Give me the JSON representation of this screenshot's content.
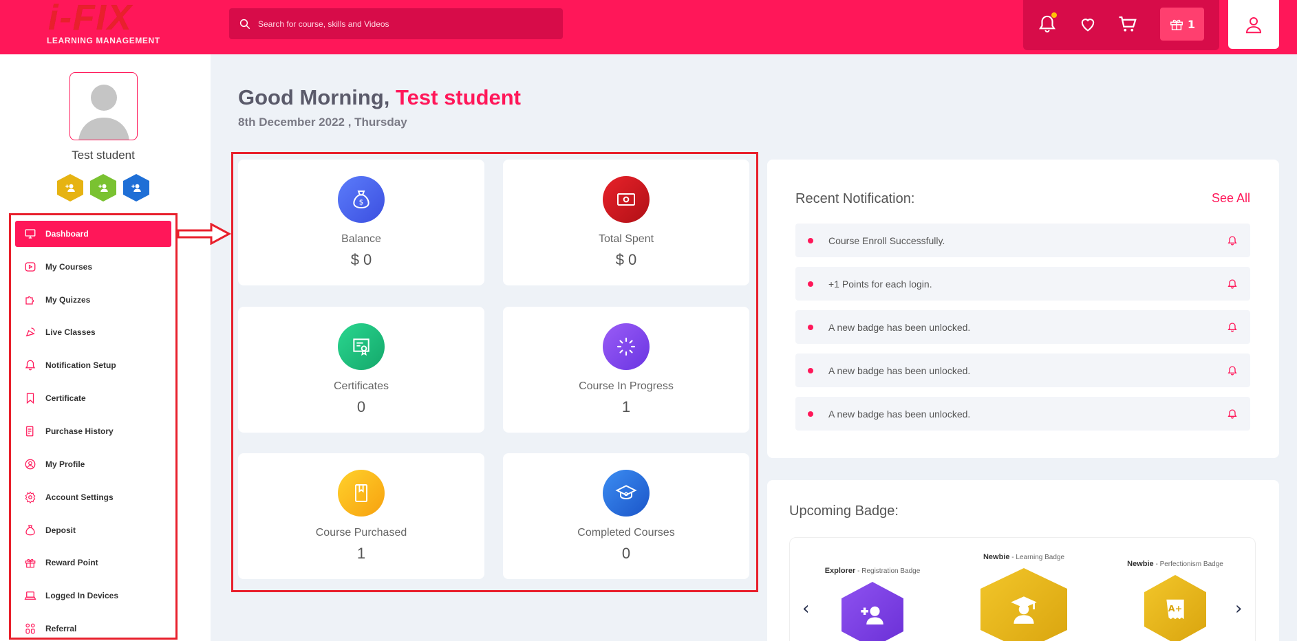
{
  "header": {
    "logo_mark": "i-FIX",
    "logo_subtitle": "LEARNING MANAGEMENT",
    "search_placeholder": "Search for course, skills and Videos",
    "gift_count": "1"
  },
  "sidebar": {
    "student_name": "Test student",
    "menu": [
      {
        "label": "Dashboard",
        "icon": "monitor-icon"
      },
      {
        "label": "My Courses",
        "icon": "play-icon"
      },
      {
        "label": "My Quizzes",
        "icon": "puzzle-icon"
      },
      {
        "label": "Live Classes",
        "icon": "broadcast-icon"
      },
      {
        "label": "Notification Setup",
        "icon": "bell-icon"
      },
      {
        "label": "Certificate",
        "icon": "bookmark-icon"
      },
      {
        "label": "Purchase History",
        "icon": "receipt-icon"
      },
      {
        "label": "My Profile",
        "icon": "user-circle-icon"
      },
      {
        "label": "Account Settings",
        "icon": "gear-icon"
      },
      {
        "label": "Deposit",
        "icon": "moneybag-icon"
      },
      {
        "label": "Reward Point",
        "icon": "gift-icon"
      },
      {
        "label": "Logged In Devices",
        "icon": "laptop-icon"
      },
      {
        "label": "Referral",
        "icon": "referral-icon"
      }
    ]
  },
  "greeting": {
    "prefix": "Good Morning,",
    "name": "Test student",
    "date": "8th December 2022 , Thursday"
  },
  "stats": [
    {
      "label": "Balance",
      "value": "$ 0",
      "icon": "money-bag-icon",
      "color": "#4a6cf7"
    },
    {
      "label": "Total Spent",
      "value": "$ 0",
      "icon": "cash-icon",
      "color": "#d4161d"
    },
    {
      "label": "Certificates",
      "value": "0",
      "icon": "certificate-icon",
      "color": "#22c583"
    },
    {
      "label": "Course In Progress",
      "value": "1",
      "icon": "spinner-icon",
      "color": "#7b4cf0"
    },
    {
      "label": "Course Purchased",
      "value": "1",
      "icon": "book-icon",
      "color": "#fbb01a"
    },
    {
      "label": "Completed Courses",
      "value": "0",
      "icon": "graduation-icon",
      "color": "#2b73e8"
    }
  ],
  "notifications": {
    "title": "Recent Notification:",
    "see_all": "See All",
    "items": [
      "Course Enroll Successfully.",
      "+1 Points for each login.",
      "A new badge has been unlocked.",
      "A new badge has been unlocked.",
      "A new badge has been unlocked."
    ]
  },
  "upcoming": {
    "title": "Upcoming Badge:",
    "badges": [
      {
        "name": "Explorer",
        "type": "Registration Badge",
        "color": "#7b3fe4"
      },
      {
        "name": "Newbie",
        "type": "Learning Badge",
        "color": "#e6b312"
      },
      {
        "name": "Newbie",
        "type": "Perfectionism Badge",
        "color": "#e6b312"
      }
    ]
  }
}
